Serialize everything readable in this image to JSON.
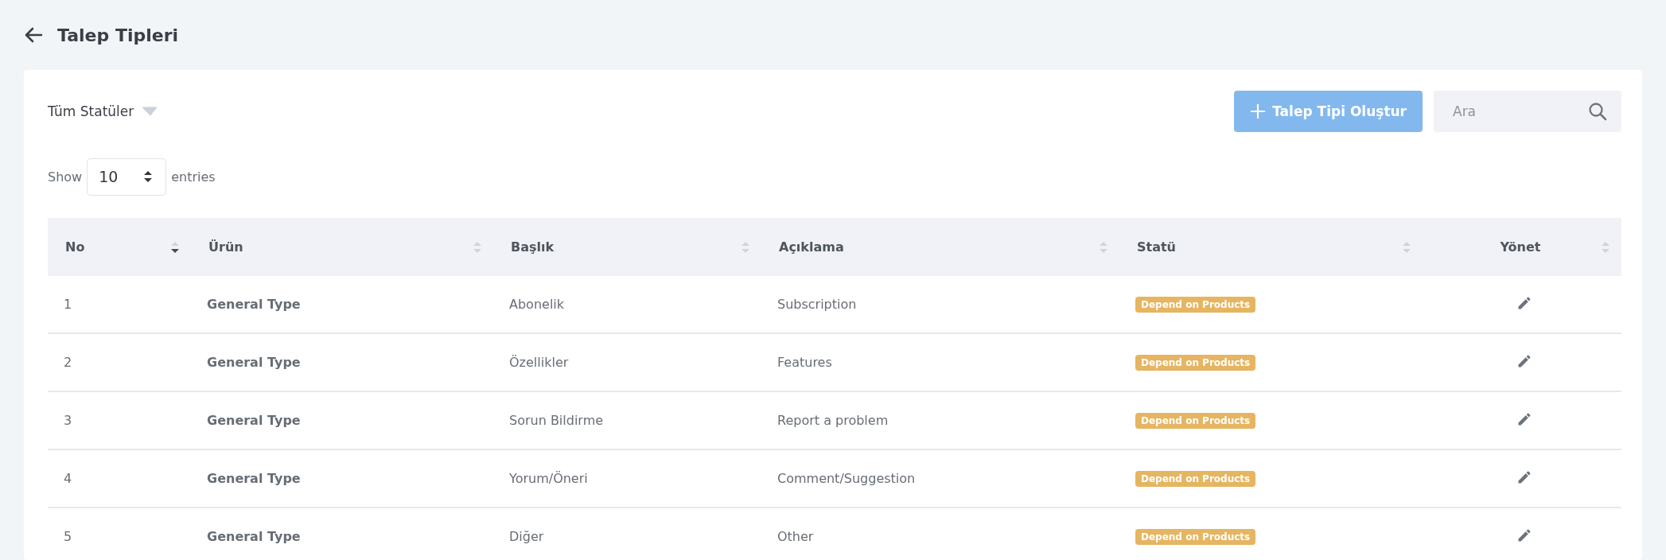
{
  "page": {
    "title": "Talep Tipleri"
  },
  "filter": {
    "label": "Tüm Statüler"
  },
  "create_button": {
    "label": "Talep Tipi Oluştur"
  },
  "search": {
    "placeholder": "Ara"
  },
  "page_length": {
    "before": "Show",
    "value": "10",
    "after": "entries"
  },
  "table": {
    "columns": [
      {
        "label": "No",
        "sorted": true
      },
      {
        "label": "Ürün",
        "sorted": false
      },
      {
        "label": "Başlık",
        "sorted": false
      },
      {
        "label": "Açıklama",
        "sorted": false
      },
      {
        "label": "Statü",
        "sorted": false
      },
      {
        "label": "Yönet",
        "sorted": false
      }
    ],
    "rows": [
      {
        "no": "1",
        "product": "General Type",
        "title": "Abonelik",
        "description": "Subscription",
        "status": "Depend on Products"
      },
      {
        "no": "2",
        "product": "General Type",
        "title": "Özellikler",
        "description": "Features",
        "status": "Depend on Products"
      },
      {
        "no": "3",
        "product": "General Type",
        "title": "Sorun Bildirme",
        "description": "Report a problem",
        "status": "Depend on Products"
      },
      {
        "no": "4",
        "product": "General Type",
        "title": "Yorum/Öneri",
        "description": "Comment/Suggestion",
        "status": "Depend on Products"
      },
      {
        "no": "5",
        "product": "General Type",
        "title": "Diğer",
        "description": "Other",
        "status": "Depend on Products"
      }
    ]
  }
}
